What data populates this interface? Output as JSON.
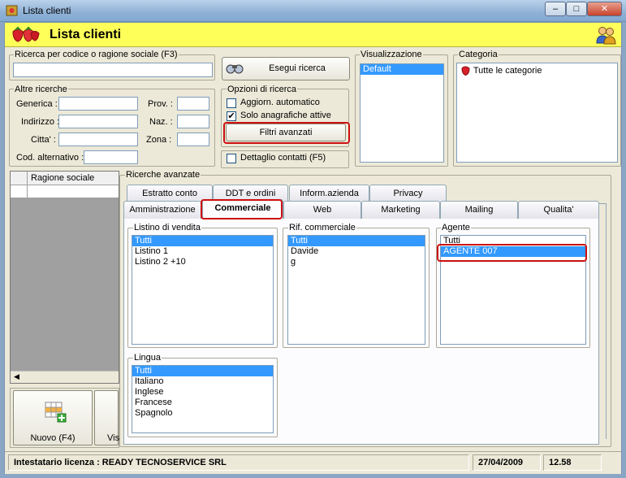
{
  "window": {
    "title": "Lista clienti"
  },
  "header": {
    "title": "Lista clienti"
  },
  "search_code": {
    "group_label": "Ricerca per codice o ragione sociale (F3)",
    "value": ""
  },
  "search_button": {
    "label": "Esegui ricerca"
  },
  "other_search": {
    "group_label": "Altre ricerche",
    "generica": "Generica :",
    "indirizzo": "Indirizzo :",
    "citta": "Citta' :",
    "cod_alt": "Cod. alternativo :",
    "prov": "Prov. :",
    "naz": "Naz. :",
    "zona": "Zona :"
  },
  "search_options": {
    "group_label": "Opzioni di ricerca",
    "auto_update": "Aggiorn. automatico",
    "auto_update_checked": false,
    "active_only": "Solo anagrafiche attive",
    "active_only_checked": true,
    "advanced_filters": "Filtri avanzati"
  },
  "contact_detail": {
    "label": "Dettaglio contatti (F5)",
    "checked": false
  },
  "visualizzazione": {
    "group_label": "Visualizzazione",
    "items": [
      "Default"
    ],
    "selected": 0
  },
  "categoria": {
    "group_label": "Categoria",
    "items": [
      "Tutte le categorie"
    ]
  },
  "grid": {
    "column": "Ragione sociale"
  },
  "advanced": {
    "group_label": "Ricerche avanzate",
    "tabs_back": [
      "Estratto conto",
      "DDT e ordini",
      "Inform.azienda",
      "Privacy"
    ],
    "tabs_front": [
      "Amministrazione",
      "Commerciale",
      "Web",
      "Marketing",
      "Mailing",
      "Qualita'"
    ],
    "active_tab": "Commerciale"
  },
  "listino": {
    "group_label": "Listino di vendita",
    "items": [
      "Tutti",
      "Listino 1",
      "Listino 2 +10"
    ],
    "selected": 0
  },
  "rif_commerciale": {
    "group_label": "Rif. commerciale",
    "items": [
      "Tutti",
      "Davide",
      "g"
    ],
    "selected": 0
  },
  "agente": {
    "group_label": "Agente",
    "items": [
      "Tutti",
      "AGENTE 007"
    ],
    "selected": 1
  },
  "lingua": {
    "group_label": "Lingua",
    "items": [
      "Tutti",
      "Italiano",
      "Inglese",
      "Francese",
      "Spagnolo"
    ],
    "selected": 0
  },
  "bottom_buttons": {
    "new": "Nuovo (F4)",
    "view": "Vis"
  },
  "status": {
    "license": "Intestatario licenza : READY TECNOSERVICE SRL",
    "date": "27/04/2009",
    "time": "12.58"
  },
  "colors": {
    "header_bg": "#ffff5a",
    "selection": "#3399ff",
    "highlight_ring": "#cc1010"
  }
}
